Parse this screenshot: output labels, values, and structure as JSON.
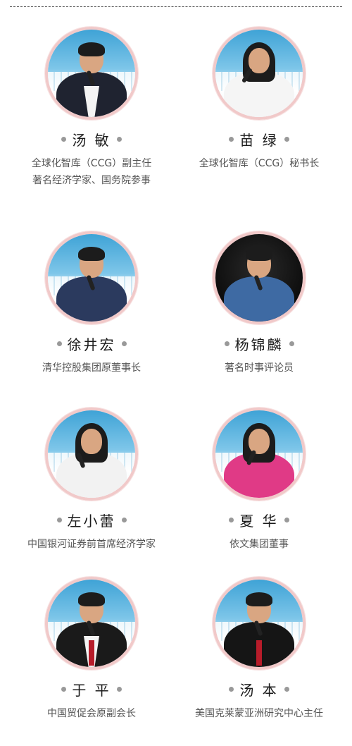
{
  "speakers": [
    {
      "name": "汤 敏",
      "titles": [
        "全球化智库（CCG）副主任",
        "著名经济学家、国务院参事"
      ],
      "avatar_icon": "portrait-man-suit-icon"
    },
    {
      "name": "苗 绿",
      "titles": [
        "全球化智库（CCG）秘书长"
      ],
      "avatar_icon": "portrait-woman-white-jacket-icon"
    },
    {
      "name": "徐井宏",
      "titles": [
        "清华控股集团原董事长"
      ],
      "avatar_icon": "portrait-man-jacket-icon"
    },
    {
      "name": "杨锦麟",
      "titles": [
        "著名时事评论员"
      ],
      "avatar_icon": "portrait-man-denim-shirt-icon"
    },
    {
      "name": "左小蕾",
      "titles": [
        "中国银河证券前首席经济学家"
      ],
      "avatar_icon": "portrait-woman-white-top-icon"
    },
    {
      "name": "夏 华",
      "titles": [
        "依文集团董事"
      ],
      "avatar_icon": "portrait-woman-pink-jacket-icon"
    },
    {
      "name": "于 平",
      "titles": [
        "中国贸促会原副会长"
      ],
      "avatar_icon": "portrait-man-red-tie-icon"
    },
    {
      "name": "汤 本",
      "titles": [
        "美国克莱蒙亚洲研究中心主任"
      ],
      "avatar_icon": "portrait-man-dark-jacket-icon"
    }
  ],
  "colors": {
    "avatar_ring": "#f1c9c9",
    "dot": "#999999",
    "name_text": "#1b1b1b",
    "title_text": "#555555"
  }
}
